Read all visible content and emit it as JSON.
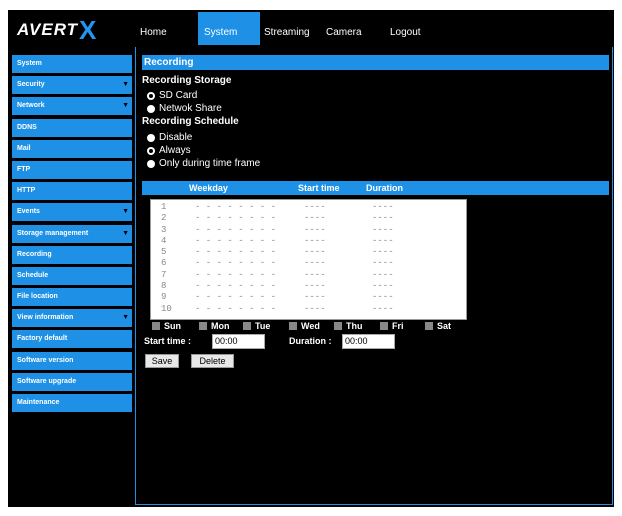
{
  "brand": {
    "logo_text": "AVERT",
    "logo_mark": "X"
  },
  "nav": [
    {
      "label": "Home",
      "active": false
    },
    {
      "label": "System",
      "active": true
    },
    {
      "label": "Streaming",
      "active": false
    },
    {
      "label": "Camera",
      "active": false
    },
    {
      "label": "Logout",
      "active": false
    }
  ],
  "sidebar": [
    {
      "label": "System",
      "has_submenu": false
    },
    {
      "label": "Security",
      "has_submenu": true
    },
    {
      "label": "Network",
      "has_submenu": true
    },
    {
      "label": "DDNS",
      "has_submenu": false
    },
    {
      "label": "Mail",
      "has_submenu": false
    },
    {
      "label": "FTP",
      "has_submenu": false
    },
    {
      "label": "HTTP",
      "has_submenu": false
    },
    {
      "label": "Events",
      "has_submenu": true
    },
    {
      "label": "Storage management",
      "has_submenu": true
    },
    {
      "label": "Recording",
      "has_submenu": false
    },
    {
      "label": "Schedule",
      "has_submenu": false
    },
    {
      "label": "File location",
      "has_submenu": false
    },
    {
      "label": "View information",
      "has_submenu": true
    },
    {
      "label": "Factory default",
      "has_submenu": false
    },
    {
      "label": "Software version",
      "has_submenu": false
    },
    {
      "label": "Software upgrade",
      "has_submenu": false
    },
    {
      "label": "Maintenance",
      "has_submenu": false
    }
  ],
  "submenu_arrow": "▼",
  "main": {
    "title": "Recording",
    "storage": {
      "heading": "Recording Storage",
      "options": [
        {
          "label": "SD Card",
          "checked": true
        },
        {
          "label": "Netwok Share",
          "checked": false
        }
      ]
    },
    "schedule": {
      "heading": "Recording Schedule",
      "options": [
        {
          "label": "Disable",
          "checked": false
        },
        {
          "label": "Always",
          "checked": true
        },
        {
          "label": "Only during time frame",
          "checked": false
        }
      ]
    },
    "table": {
      "columns": [
        "Weekday",
        "Start time",
        "Duration"
      ],
      "rows": [
        {
          "num": "1",
          "weekday": "- - - - - - - -",
          "start": "----",
          "duration": "----"
        },
        {
          "num": "2",
          "weekday": "- - - - - - - -",
          "start": "----",
          "duration": "----"
        },
        {
          "num": "3",
          "weekday": "- - - - - - - -",
          "start": "----",
          "duration": "----"
        },
        {
          "num": "4",
          "weekday": "- - - - - - - -",
          "start": "----",
          "duration": "----"
        },
        {
          "num": "5",
          "weekday": "- - - - - - - -",
          "start": "----",
          "duration": "----"
        },
        {
          "num": "6",
          "weekday": "- - - - - - - -",
          "start": "----",
          "duration": "----"
        },
        {
          "num": "7",
          "weekday": "- - - - - - - -",
          "start": "----",
          "duration": "----"
        },
        {
          "num": "8",
          "weekday": "- - - - - - - -",
          "start": "----",
          "duration": "----"
        },
        {
          "num": "9",
          "weekday": "- - - - - - - -",
          "start": "----",
          "duration": "----"
        },
        {
          "num": "10",
          "weekday": "- - - - - - - -",
          "start": "----",
          "duration": "----"
        }
      ]
    },
    "days": [
      "Sun",
      "Mon",
      "Tue",
      "Wed",
      "Thu",
      "Fri",
      "Sat"
    ],
    "start_time": {
      "label": "Start time :",
      "value": "00:00"
    },
    "duration": {
      "label": "Duration :",
      "value": "00:00"
    },
    "buttons": {
      "save": "Save",
      "delete": "Delete"
    }
  },
  "colors": {
    "accent": "#1e90e6",
    "background": "#000000"
  }
}
